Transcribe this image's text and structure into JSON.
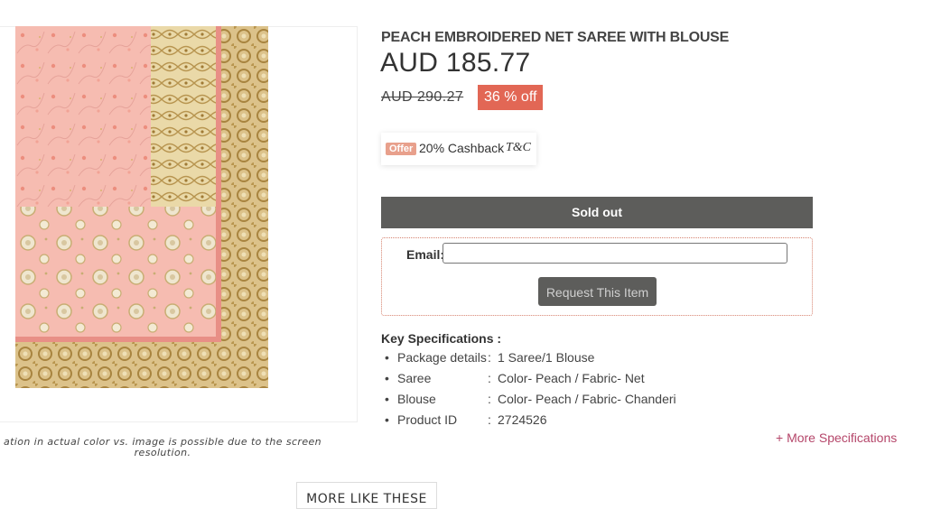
{
  "product": {
    "title": "PEACH EMBROIDERED NET SAREE WITH BLOUSE",
    "price": "AUD 185.77",
    "original_price": "AUD 290.27",
    "discount": "36 % off",
    "image_disclaimer": "ation in actual color vs. image is possible due to the screen resolution."
  },
  "offer": {
    "badge": "Offer",
    "text": "20% Cashback",
    "terms_link": "T&C"
  },
  "purchase": {
    "status_button": "Sold out",
    "email_label": "Email:",
    "email_value": "",
    "request_button": "Request This Item"
  },
  "specs": {
    "heading": "Key Specifications :",
    "items": [
      {
        "key": "Package details",
        "value": "1 Saree/1 Blouse"
      },
      {
        "key": "Saree",
        "value": "Color- Peach / Fabric- Net"
      },
      {
        "key": "Blouse",
        "value": "Color- Peach / Fabric- Chanderi"
      },
      {
        "key": "Product ID",
        "value": "2724526"
      }
    ],
    "more_link": "+ More Specifications"
  },
  "more_like_these": "MORE LIKE THESE",
  "colors": {
    "discount_badge": "#e26755",
    "sold_out_bg": "#5d5d5b",
    "link": "#b5466a",
    "saree_peach": "#f5b9ad",
    "border_gold": "#c9ac6a"
  }
}
